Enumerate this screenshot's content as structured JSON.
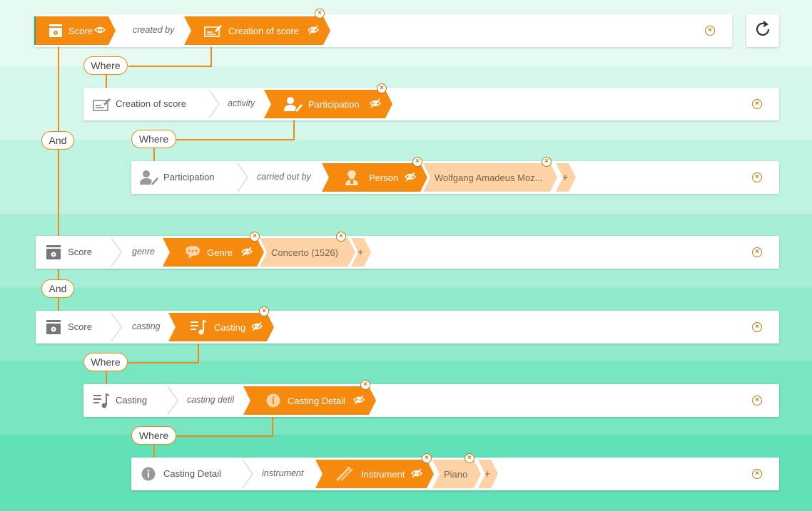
{
  "colors": {
    "accent": "#f68a0f",
    "accent_light": "#fdd3a6",
    "line": "#ef8a14"
  },
  "row1": {
    "subject": "Score",
    "property": "created by",
    "object": "Creation of score"
  },
  "connectors": {
    "where": "Where",
    "and": "And"
  },
  "row2": {
    "subject": "Creation of score",
    "property": "activity",
    "object": "Participation"
  },
  "row3": {
    "subject": "Participation",
    "property": "carried out by",
    "object": "Person",
    "value": "Wolfgang Amadeus Moz...",
    "add": "+"
  },
  "row4": {
    "subject": "Score",
    "property": "genre",
    "object": "Genre",
    "value": "Concerto (1526)",
    "add": "+"
  },
  "row5": {
    "subject": "Score",
    "property": "casting",
    "object": "Casting"
  },
  "row6": {
    "subject": "Casting",
    "property": "casting detil",
    "object": "Casting Detail"
  },
  "row7": {
    "subject": "Casting Detail",
    "property": "instrument",
    "object": "Instrument",
    "value": "Piano",
    "add": "+"
  },
  "icons": {
    "score": "score-icon",
    "creation": "creation-icon",
    "participation": "participation-icon",
    "person": "person-icon",
    "genre": "genre-icon",
    "casting": "casting-icon",
    "casting_detail": "info-icon",
    "instrument": "instrument-icon",
    "eye": "eye-icon",
    "eye_off": "eye-off-icon",
    "close": "close-icon",
    "refresh": "refresh-icon"
  }
}
